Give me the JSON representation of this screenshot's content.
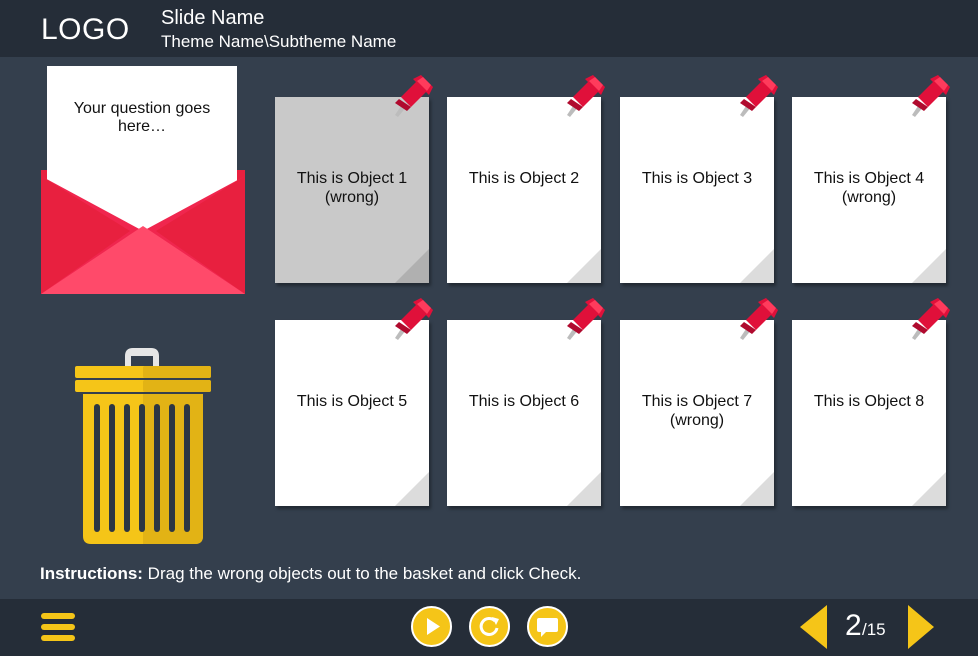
{
  "header": {
    "logo": "LOGO",
    "slide_name": "Slide Name",
    "theme_name": "Theme Name\\Subtheme Name"
  },
  "question": {
    "text": "Your question goes here…"
  },
  "objects": [
    {
      "line1": "This is Object 1",
      "line2": "(wrong)"
    },
    {
      "line1": "This is Object 2",
      "line2": ""
    },
    {
      "line1": "This is Object 3",
      "line2": ""
    },
    {
      "line1": "This is Object 4",
      "line2": "(wrong)"
    },
    {
      "line1": "This is Object 5",
      "line2": ""
    },
    {
      "line1": "This is Object 6",
      "line2": ""
    },
    {
      "line1": "This is Object 7",
      "line2": "(wrong)"
    },
    {
      "line1": "This is Object 8",
      "line2": ""
    }
  ],
  "instructions": {
    "label": "Instructions:",
    "text": " Drag the wrong objects out to the basket and click Check."
  },
  "footer": {
    "page_current": "2",
    "page_total": "/15"
  },
  "icons": {
    "menu": "hamburger-menu-icon",
    "play": "play-icon",
    "replay": "replay-icon",
    "comment": "comment-icon",
    "prev": "prev-arrow-icon",
    "next": "next-arrow-icon",
    "envelope": "envelope-icon",
    "bin": "trash-bin-icon",
    "pin": "push-pin-icon"
  },
  "colors": {
    "accent": "#f5c518",
    "envelope": "#f0264e",
    "pin": "#e0103a",
    "header_bg": "#252d38",
    "stage_bg": "#343f4d",
    "selected_note": "#c9c9c9"
  }
}
